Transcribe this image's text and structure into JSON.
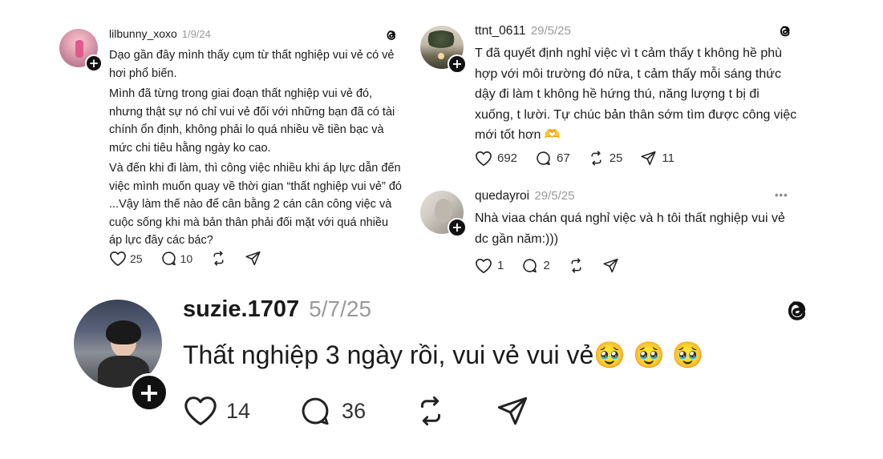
{
  "posts": [
    {
      "username": "lilbunny_xoxo",
      "date": "1/9/24",
      "paragraphs": [
        "Dạo gần đây mình thấy cụm từ thất nghiệp vui vẻ có vẻ hơi phổ biến.",
        "Mình đã từng trong giai đoạn thất nghiệp vui vẻ đó, nhưng thật sự nó chỉ vui vẻ đối với những bạn đã có tài chính ổn định, không phải lo quá nhiều về tiền bạc và mức chi tiêu hằng ngày ko cao.",
        "Và đến khi đi làm, thì công việc nhiều khi áp lực dẫn đến việc mình muốn quay về thời gian “thất nghiệp vui vẻ” đó ...Vậy làm thế nào để cân bằng 2 cán cân công việc và cuộc sống khi mà bản thân phải đối mặt với quá nhiều áp lực đây các bác?"
      ],
      "likes": "25",
      "replies": "10",
      "reposts": "",
      "icon": "threads-logo-icon"
    },
    {
      "username": "ttnt_0611",
      "date": "29/5/25",
      "paragraphs": [
        "T đã quyết định nghỉ việc vì t cảm thấy t không hề phù hợp với môi trường đó nữa, t cảm thấy mỗi sáng thức dậy đi làm t không hề hứng thú, năng lượng t bị đi xuống, t lười. Tự chúc bản thân sớm tìm được công việc mới tốt hơn 🫶"
      ],
      "likes": "692",
      "replies": "67",
      "reposts": "25",
      "shares": "11",
      "icon": "threads-logo-icon"
    },
    {
      "username": "quedayroi",
      "date": "29/5/25",
      "paragraphs": [
        "Nhà viaa chán quá nghỉ việc và h tôi thất nghiệp vui vẻ dc gần năm:)))"
      ],
      "likes": "1",
      "replies": "2",
      "reposts": "",
      "more": "•••"
    },
    {
      "username": "suzie.1707",
      "date": "5/7/25",
      "paragraphs": [
        "Thất nghiệp 3 ngày rồi, vui vẻ vui vẻ🥹 🥹 🥹"
      ],
      "likes": "14",
      "replies": "36",
      "reposts": "",
      "icon": "threads-logo-icon"
    }
  ],
  "colors": {
    "text": "#1a1a1a",
    "muted": "#9a9a9a",
    "accent": "#111111"
  }
}
